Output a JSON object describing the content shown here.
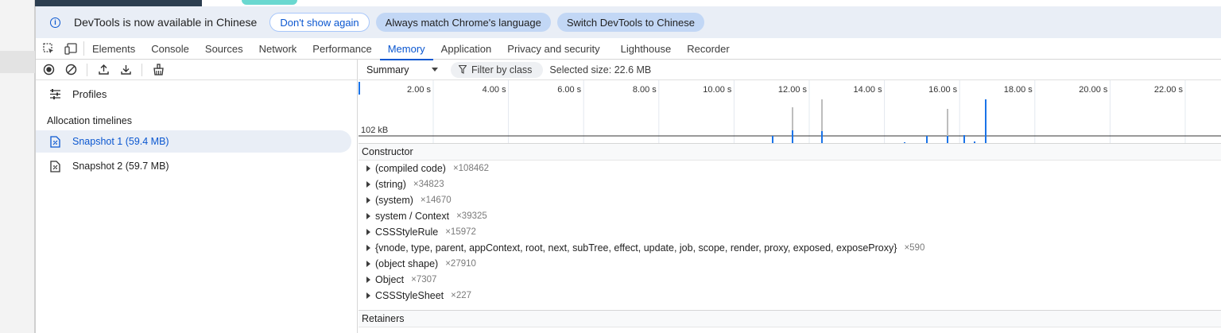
{
  "infobar": {
    "message": "DevTools is now available in Chinese",
    "buttons": [
      "Don't show again",
      "Always match Chrome's language",
      "Switch DevTools to Chinese"
    ]
  },
  "tabs": [
    "Elements",
    "Console",
    "Sources",
    "Network",
    "Performance",
    "Memory",
    "Application",
    "Privacy and security",
    "Lighthouse",
    "Recorder"
  ],
  "active_tab": "Memory",
  "sidebar": {
    "profiles_label": "Profiles",
    "section_title": "Allocation timelines",
    "snapshots": [
      {
        "label": "Snapshot 1 (59.4 MB)",
        "selected": true
      },
      {
        "label": "Snapshot 2 (59.7 MB)",
        "selected": false
      }
    ]
  },
  "toolbar": {
    "view_select": "Summary",
    "filter_placeholder": "Filter by class",
    "selected_size": "Selected size: 22.6 MB"
  },
  "timeline": {
    "ticks": [
      "2.00 s",
      "4.00 s",
      "6.00 s",
      "8.00 s",
      "10.00 s",
      "12.00 s",
      "14.00 s",
      "16.00 s",
      "18.00 s",
      "20.00 s",
      "22.00 s"
    ],
    "scale_label": "102 kB",
    "accent": "#1a73e8",
    "grey_bar": "#bdbdbd"
  },
  "table": {
    "header": "Constructor",
    "rows": [
      {
        "name": "(compiled code)",
        "count": "×108462"
      },
      {
        "name": "(string)",
        "count": "×34823"
      },
      {
        "name": "(system)",
        "count": "×14670"
      },
      {
        "name": "system / Context",
        "count": "×39325"
      },
      {
        "name": "CSSStyleRule",
        "count": "×15972"
      },
      {
        "name": "{vnode, type, parent, appContext, root, next, subTree, effect, update, job, scope, render, proxy, exposed, exposeProxy}",
        "count": "×590"
      },
      {
        "name": "(object shape)",
        "count": "×27910"
      },
      {
        "name": "Object",
        "count": "×7307"
      },
      {
        "name": "CSSStyleSheet",
        "count": "×227"
      }
    ],
    "retainers_header": "Retainers"
  }
}
